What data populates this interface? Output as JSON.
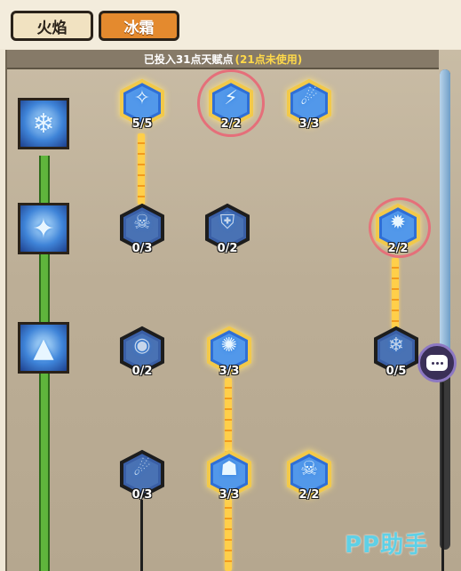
{
  "tabs": [
    {
      "label": "火焰",
      "active": false
    },
    {
      "label": "冰霜",
      "active": true
    }
  ],
  "points_summary": {
    "invested": "已投入31点天赋点",
    "unused": "(21点未使用)"
  },
  "tiers": [
    {
      "icon": "frost-shard-icon",
      "glyph": "❄"
    },
    {
      "icon": "frost-orbs-icon",
      "glyph": "✦"
    },
    {
      "icon": "ice-spikes-icon",
      "glyph": "▲"
    }
  ],
  "talents": [
    {
      "id": "ice-staff",
      "icon": "ice-staff-icon",
      "glyph": "✧",
      "rank": "5/5",
      "active": true,
      "highlighted": false
    },
    {
      "id": "frost-blade",
      "icon": "frost-blade-icon",
      "glyph": "⚡",
      "rank": "2/2",
      "active": true,
      "highlighted": true
    },
    {
      "id": "frost-comet",
      "icon": "frost-comet-icon",
      "glyph": "☄",
      "rank": "3/3",
      "active": true,
      "highlighted": false
    },
    {
      "id": "frost-skull",
      "icon": "skull-icon",
      "glyph": "☠",
      "rank": "0/3",
      "active": false,
      "highlighted": false
    },
    {
      "id": "ice-shield",
      "icon": "shield-icon",
      "glyph": "⛨",
      "rank": "0/2",
      "active": false,
      "highlighted": false
    },
    {
      "id": "ice-crystal",
      "icon": "ice-crystal-icon",
      "glyph": "✹",
      "rank": "2/2",
      "active": true,
      "highlighted": true
    },
    {
      "id": "frost-eye",
      "icon": "eye-icon",
      "glyph": "◉",
      "rank": "0/2",
      "active": false,
      "highlighted": false
    },
    {
      "id": "frost-shower",
      "icon": "frost-shower-icon",
      "glyph": "✺",
      "rank": "3/3",
      "active": true,
      "highlighted": false
    },
    {
      "id": "snowflake-burst",
      "icon": "snowflake-icon",
      "glyph": "❄",
      "rank": "0/5",
      "active": false,
      "highlighted": false
    },
    {
      "id": "frost-bolt",
      "icon": "frost-bolt-icon",
      "glyph": "☄",
      "rank": "0/3",
      "active": false,
      "highlighted": false
    },
    {
      "id": "stone-golem",
      "icon": "golem-icon",
      "glyph": "☗",
      "rank": "3/3",
      "active": true,
      "highlighted": false
    },
    {
      "id": "frozen-skull",
      "icon": "frozen-skull-icon",
      "glyph": "☠",
      "rank": "2/2",
      "active": true,
      "highlighted": false
    }
  ],
  "colors": {
    "active_tab": "#e48a2e",
    "points_unused": "#ffd94a",
    "highlight_ring": "#e56f7a",
    "connector_active": "#ffcf4a",
    "tier_line": "#5fb53c"
  },
  "watermark": "PP助手"
}
